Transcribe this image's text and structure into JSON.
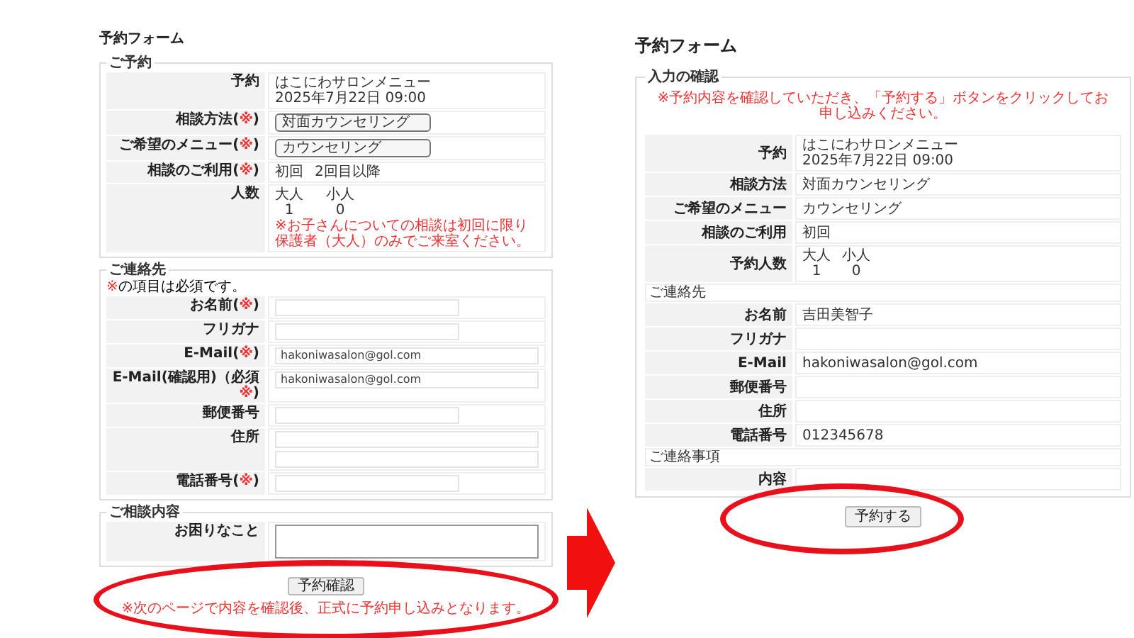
{
  "left_form": {
    "title": "予約フォーム",
    "sections": [
      {
        "legend": "ご予約",
        "rows": [
          {
            "kind": "text",
            "label": "予約",
            "lines": [
              "はこにわサロンメニュー",
              "2025年7月22日 09:00"
            ]
          },
          {
            "kind": "select",
            "label": "相談方法(",
            "required": "※",
            "label_end": ")",
            "value": "対面カウンセリング"
          },
          {
            "kind": "select",
            "label": "ご希望のメニュー(",
            "required": "※",
            "label_end": ")",
            "value": "カウンセリング"
          },
          {
            "kind": "choice",
            "label": "相談のご利用(",
            "required": "※",
            "label_end": ")",
            "options": [
              "初回",
              "2回目以降"
            ]
          },
          {
            "kind": "people",
            "label": "人数",
            "groups": [
              {
                "name": "大人",
                "count": "1"
              },
              {
                "name": "小人",
                "count": "0"
              }
            ],
            "note": "※お子さんについての相談は初回に限り保護者（大人）のみでご来室ください。"
          }
        ]
      },
      {
        "legend": "ご連絡先",
        "note_mark": "※",
        "note": "の項目は必須です。",
        "rows": [
          {
            "kind": "input",
            "label": "お名前(",
            "required": "※",
            "label_end": ")"
          },
          {
            "kind": "input",
            "label": "フリガナ"
          },
          {
            "kind": "input",
            "label": "E-Mail(",
            "required": "※",
            "label_end": ")",
            "value": "hakoniwasalon@gol.com"
          },
          {
            "kind": "input",
            "label": "E-Mail(確認用)（必須",
            "required": "※",
            "label_end": ")",
            "value": "hakoniwasalon@gol.com"
          },
          {
            "kind": "input",
            "label": "郵便番号"
          },
          {
            "kind": "address",
            "label": "住所"
          },
          {
            "kind": "input",
            "label": "電話番号(",
            "required": "※",
            "label_end": ")"
          }
        ]
      },
      {
        "legend": "ご相談内容",
        "rows": [
          {
            "kind": "textarea",
            "label": "お困りなこと"
          }
        ]
      }
    ],
    "button": "予約確認",
    "footnote": "※次のページで内容を確認後、正式に予約申し込みとなります。"
  },
  "right_form": {
    "title": "予約フォーム",
    "legend": "入力の確認",
    "notice": "※予約内容を確認していただき、「予約する」ボタンをクリックしてお申し込みください。",
    "rows": [
      {
        "kind": "row",
        "label": "予約",
        "lines": [
          "はこにわサロンメニュー",
          "2025年7月22日 09:00"
        ]
      },
      {
        "kind": "row",
        "label": "相談方法",
        "lines": [
          "対面カウンセリング"
        ]
      },
      {
        "kind": "row",
        "label": "ご希望のメニュー",
        "lines": [
          "カウンセリング"
        ]
      },
      {
        "kind": "row",
        "label": "相談のご利用",
        "lines": [
          "初回"
        ]
      },
      {
        "kind": "people",
        "label": "予約人数",
        "groups": [
          {
            "name": "大人",
            "count": "1"
          },
          {
            "name": "小人",
            "count": "0"
          }
        ]
      },
      {
        "kind": "heading",
        "text": "ご連絡先"
      },
      {
        "kind": "row",
        "label": "お名前",
        "lines": [
          "吉田美智子"
        ]
      },
      {
        "kind": "row",
        "label": "フリガナ",
        "lines": []
      },
      {
        "kind": "row",
        "label": "E-Mail",
        "lines": [
          "hakoniwasalon@gol.com"
        ]
      },
      {
        "kind": "row",
        "label": "郵便番号",
        "lines": []
      },
      {
        "kind": "row",
        "label": "住所",
        "lines": []
      },
      {
        "kind": "row",
        "label": "電話番号",
        "lines": [
          "012345678"
        ]
      },
      {
        "kind": "heading",
        "text": "ご連絡事項"
      },
      {
        "kind": "row",
        "label": "内容",
        "lines": []
      }
    ],
    "button": "予約する"
  }
}
